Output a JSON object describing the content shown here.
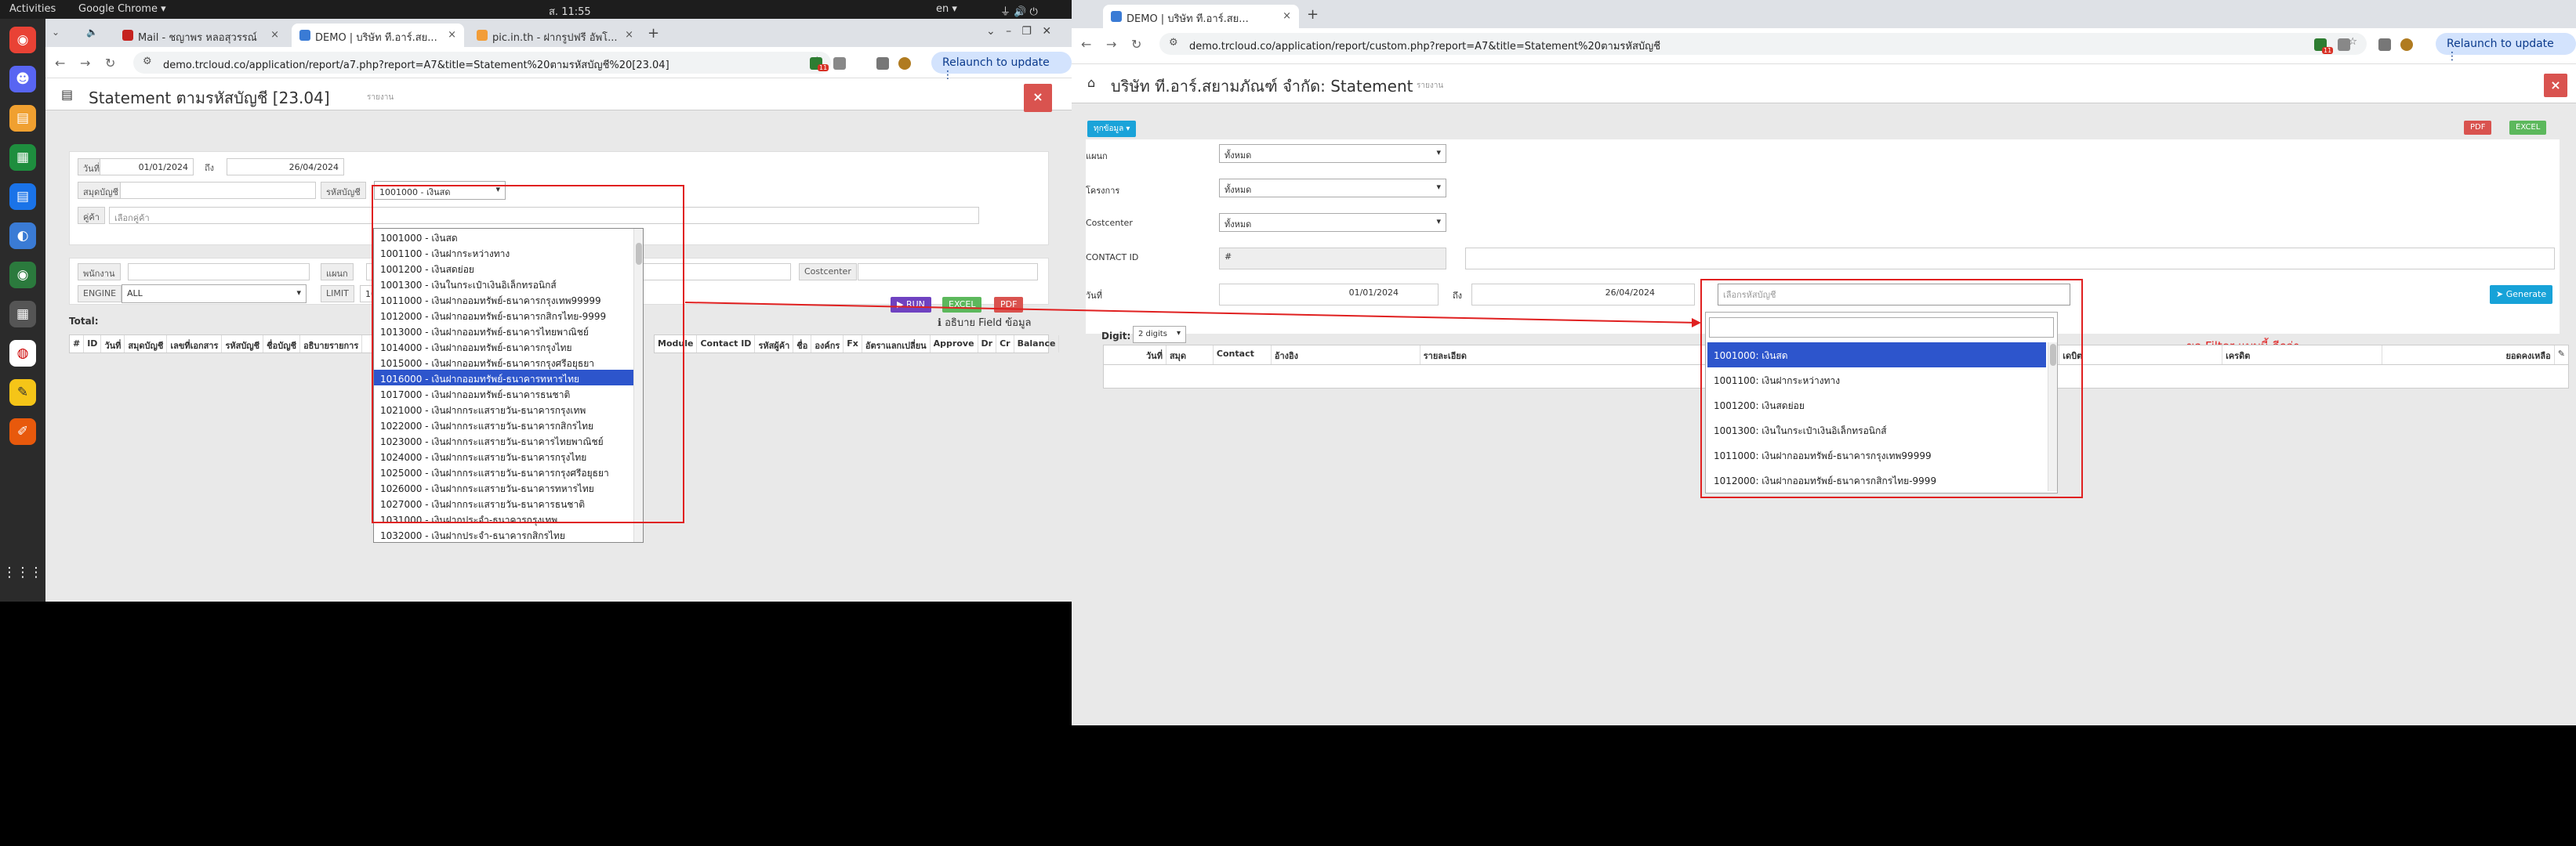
{
  "topbar": {
    "activities": "Activities",
    "app": "Google Chrome ▾",
    "clock": "ส. 11:55",
    "lang": "en ▾"
  },
  "dock": [
    "chrome-icon",
    "discord-icon",
    "files-icon",
    "sheets-icon",
    "docs-icon",
    "app-icon",
    "chrome-canary-icon",
    "calculator-icon",
    "ubuntu-icon",
    "editor-icon",
    "draw-icon",
    "apps-grid-icon"
  ],
  "left": {
    "tabs": [
      "Mail - ชญาพร หลอสุวรรณ์",
      "DEMO | บริษัท ที.อาร์.สย...",
      "pic.in.th - ฝากรูปฟรี อัพโ..."
    ],
    "url": "demo.trcloud.co/application/report/a7.php?report=A7&title=Statement%20ตามรหัสบัญชี%20[23.04]",
    "relaunch": "Relaunch to update",
    "ext_badge": "11",
    "title": "Statement ตามรหัสบัญชี [23.04]",
    "subtitle": "รายงาน",
    "close": "×",
    "form": {
      "date_label": "วันที่",
      "date_from": "01/01/2024",
      "to": "ถึง",
      "date_to": "26/04/2024",
      "book_label": "สมุดบัญชี",
      "account_label": "รหัสบัญชี",
      "account_value": "1001000 - เงินสด",
      "customer_label": "คู่ค้า",
      "customer_placeholder": "เลือกคู่ค้า",
      "employee_label": "พนักงาน",
      "dept_label": "แผนก",
      "costcenter_label": "Costcenter",
      "engine_label": "ENGINE",
      "engine_value": "ALL",
      "limit_label": "LIMIT",
      "limit_value": "10"
    },
    "buttons": {
      "run": "▶ RUN",
      "excel": "EXCEL",
      "pdf": "PDF"
    },
    "total_label": "Total:",
    "hint": "ℹ อธิบาย Field ข้อมูล",
    "columns_left": [
      "#",
      "ID",
      "วันที่",
      "สมุดบัญชี",
      "เลขที่เอกสาร",
      "รหัสบัญชี",
      "ชื่อบัญชี",
      "อธิบายรายการ"
    ],
    "columns_right": [
      "Module",
      "Contact ID",
      "รหัสผู้ค้า",
      "ชื่อ",
      "องค์กร",
      "Fx",
      "อัตราแลกเปลี่ยน",
      "Approve",
      "Dr",
      "Cr",
      "Balance"
    ],
    "dropdown": [
      "1001000 - เงินสด",
      "1001100 - เงินฝากระหว่างทาง",
      "1001200 - เงินสดย่อย",
      "1001300 - เงินในกระเป๋าเงินอิเล็กทรอนิกส์",
      "1011000 - เงินฝากออมทรัพย์-ธนาคารกรุงเทพ99999",
      "1012000 - เงินฝากออมทรัพย์-ธนาคารกสิกรไทย-9999",
      "1013000 - เงินฝากออมทรัพย์-ธนาคารไทยพาณิชย์",
      "1014000 - เงินฝากออมทรัพย์-ธนาคารกรุงไทย",
      "1015000 - เงินฝากออมทรัพย์-ธนาคารกรุงศรีอยุธยา",
      "1016000 - เงินฝากออมทรัพย์-ธนาคารทหารไทย",
      "1017000 - เงินฝากออมทรัพย์-ธนาคารธนชาติ",
      "1021000 - เงินฝากกระแสรายวัน-ธนาคารกรุงเทพ",
      "1022000 - เงินฝากกระแสรายวัน-ธนาคารกสิกรไทย",
      "1023000 - เงินฝากกระแสรายวัน-ธนาคารไทยพาณิชย์",
      "1024000 - เงินฝากกระแสรายวัน-ธนาคารกรุงไทย",
      "1025000 - เงินฝากกระแสรายวัน-ธนาคารกรุงศรีอยุธยา",
      "1026000 - เงินฝากกระแสรายวัน-ธนาคารทหารไทย",
      "1027000 - เงินฝากกระแสรายวัน-ธนาคารธนชาติ",
      "1031000 - เงินฝากประจำ-ธนาคารกรุงเทพ",
      "1032000 - เงินฝากประจำ-ธนาคารกสิกรไทย"
    ],
    "dropdown_selected_index": 9
  },
  "right": {
    "tab": "DEMO | บริษัท ที.อาร์.สย...",
    "url": "demo.trcloud.co/application/report/custom.php?report=A7&title=Statement%20ตามรหัสบัญชี",
    "relaunch": "Relaunch to update",
    "ext_badge": "11",
    "title": "บริษัท ที.อาร์.สยามภัณฑ์ จำกัด: Statement",
    "subtitle": "รายงาน",
    "close": "×",
    "all_data": "ทุกข้อมูล ▾",
    "pdf": "PDF",
    "excel": "EXCEL",
    "form": {
      "dept_label": "แผนก",
      "dept_value": "ทั้งหมด",
      "project_label": "โครงการ",
      "project_value": "ทั้งหมด",
      "costcenter_label": "Costcenter",
      "costcenter_value": "ทั้งหมด",
      "contact_label": "CONTACT ID",
      "contact_value": "#",
      "date_label": "วันที่",
      "date_from": "01/01/2024",
      "to": "ถึง",
      "date_to": "26/04/2024",
      "account_placeholder": "เลือกรหัสบัญชี",
      "generate": "➤ Generate"
    },
    "digit_label": "Digit:",
    "digit_value": "2 digits",
    "columns": [
      "วันที่",
      "สมุด",
      "Contact",
      "อ้างอิง",
      "รายละเอียด",
      "เดบิต",
      "เครดิต",
      "ยอดคงเหลือ"
    ],
    "annotation": "ขอ Filter แบบนี้ อีกว่า",
    "dropdown": [
      "1001000: เงินสด",
      "1001100: เงินฝากระหว่างทาง",
      "1001200: เงินสดย่อย",
      "1001300: เงินในกระเป๋าเงินอิเล็กทรอนิกส์",
      "1011000: เงินฝากออมทรัพย์-ธนาคารกรุงเทพ99999",
      "1012000: เงินฝากออมทรัพย์-ธนาคารกสิกรไทย-9999"
    ],
    "dropdown_selected_index": 0
  },
  "colors": {
    "accent_red": "#e02020",
    "run_purple": "#6f42c1",
    "excel_green": "#5cb85c",
    "pdf_red": "#d9534f",
    "generate_blue": "#17a2d8",
    "select_blue": "#2d55cc"
  }
}
